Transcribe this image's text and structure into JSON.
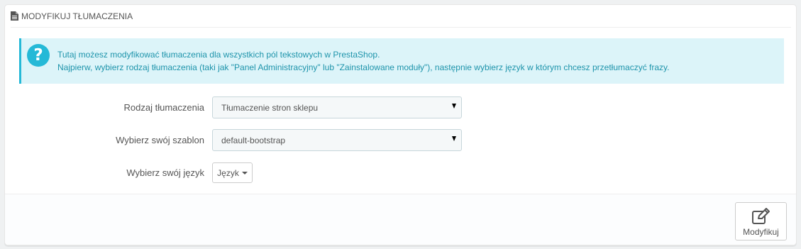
{
  "panel": {
    "heading": "MODYFIKUJ TŁUMACZENIA",
    "heading_icon": "document-icon"
  },
  "alert": {
    "icon": "question-icon",
    "icon_glyph": "?",
    "line1": "Tutaj możesz modyfikować tłumaczenia dla wszystkich pól tekstowych w PrestaShop.",
    "line2": "Najpierw, wybierz rodzaj tłumaczenia (taki jak \"Panel Administracyjny\" lub \"Zainstalowane moduły\"), następnie wybierz język w którym chcesz przetłumaczyć frazy.",
    "accent": "#25b9d7"
  },
  "form": {
    "type_label": "Rodzaj tłumaczenia",
    "type_value": "Tłumaczenie stron sklepu",
    "theme_label": "Wybierz swój szablon",
    "theme_value": "default-bootstrap",
    "lang_label": "Wybierz swój język",
    "lang_button": "Język"
  },
  "footer": {
    "save_label": "Modyfikuj",
    "save_icon": "edit-icon"
  }
}
